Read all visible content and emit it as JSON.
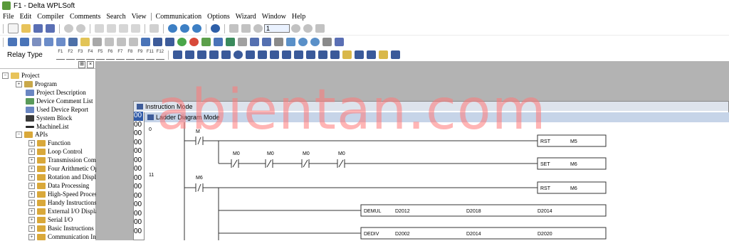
{
  "window": {
    "title": "F1 - Delta WPLSoft"
  },
  "menu": [
    "File",
    "Edit",
    "Compiler",
    "Comments",
    "Search",
    "View",
    "Communication",
    "Options",
    "Wizard",
    "Window",
    "Help"
  ],
  "toolbar": {
    "step_value": "1",
    "relay_type_label": "Relay Type"
  },
  "function_keys": [
    "F1",
    "F2",
    "F3",
    "F4",
    "F5",
    "F6",
    "F7",
    "F8",
    "F9",
    "F11",
    "F12"
  ],
  "tree": {
    "root": "Project",
    "items": [
      "Program",
      "Project Description",
      "Device Comment List",
      "Used Device Report",
      "System Block",
      "MachineList",
      "APIs"
    ],
    "apis": [
      "Function",
      "Loop Control",
      "Transmission Comp",
      "Four Arithmetic Op",
      "Rotation and Displ",
      "Data Processing",
      "High-Speed Process",
      "Handy Instructions",
      "External I/O Displa",
      "Serial I/O",
      "Basic Instructions",
      "Communication Ins"
    ]
  },
  "windows": {
    "instruction_title": "Instruction Mode",
    "ladder_title": "Ladder Diagram Mode"
  },
  "address_column": [
    "00",
    "00",
    "00",
    "00",
    "00",
    "00",
    "00",
    "00",
    "00",
    "00",
    "00",
    "00",
    "00",
    "00"
  ],
  "ladder": {
    "step_labels": [
      "0",
      "11"
    ],
    "contacts": [
      "M",
      "M0",
      "M0",
      "M0",
      "M0",
      "M6"
    ],
    "boxes": [
      {
        "op": "RST",
        "a": "M5",
        "b": "",
        "c": ""
      },
      {
        "op": "SET",
        "a": "M6",
        "b": "",
        "c": ""
      },
      {
        "op": "RST",
        "a": "M6",
        "b": "",
        "c": ""
      },
      {
        "op": "DEMUL",
        "a": "D2012",
        "b": "D2018",
        "c": "D2014"
      },
      {
        "op": "DEDIV",
        "a": "D2002",
        "b": "D2014",
        "c": "D2020"
      }
    ]
  },
  "watermark": "abientan.com"
}
